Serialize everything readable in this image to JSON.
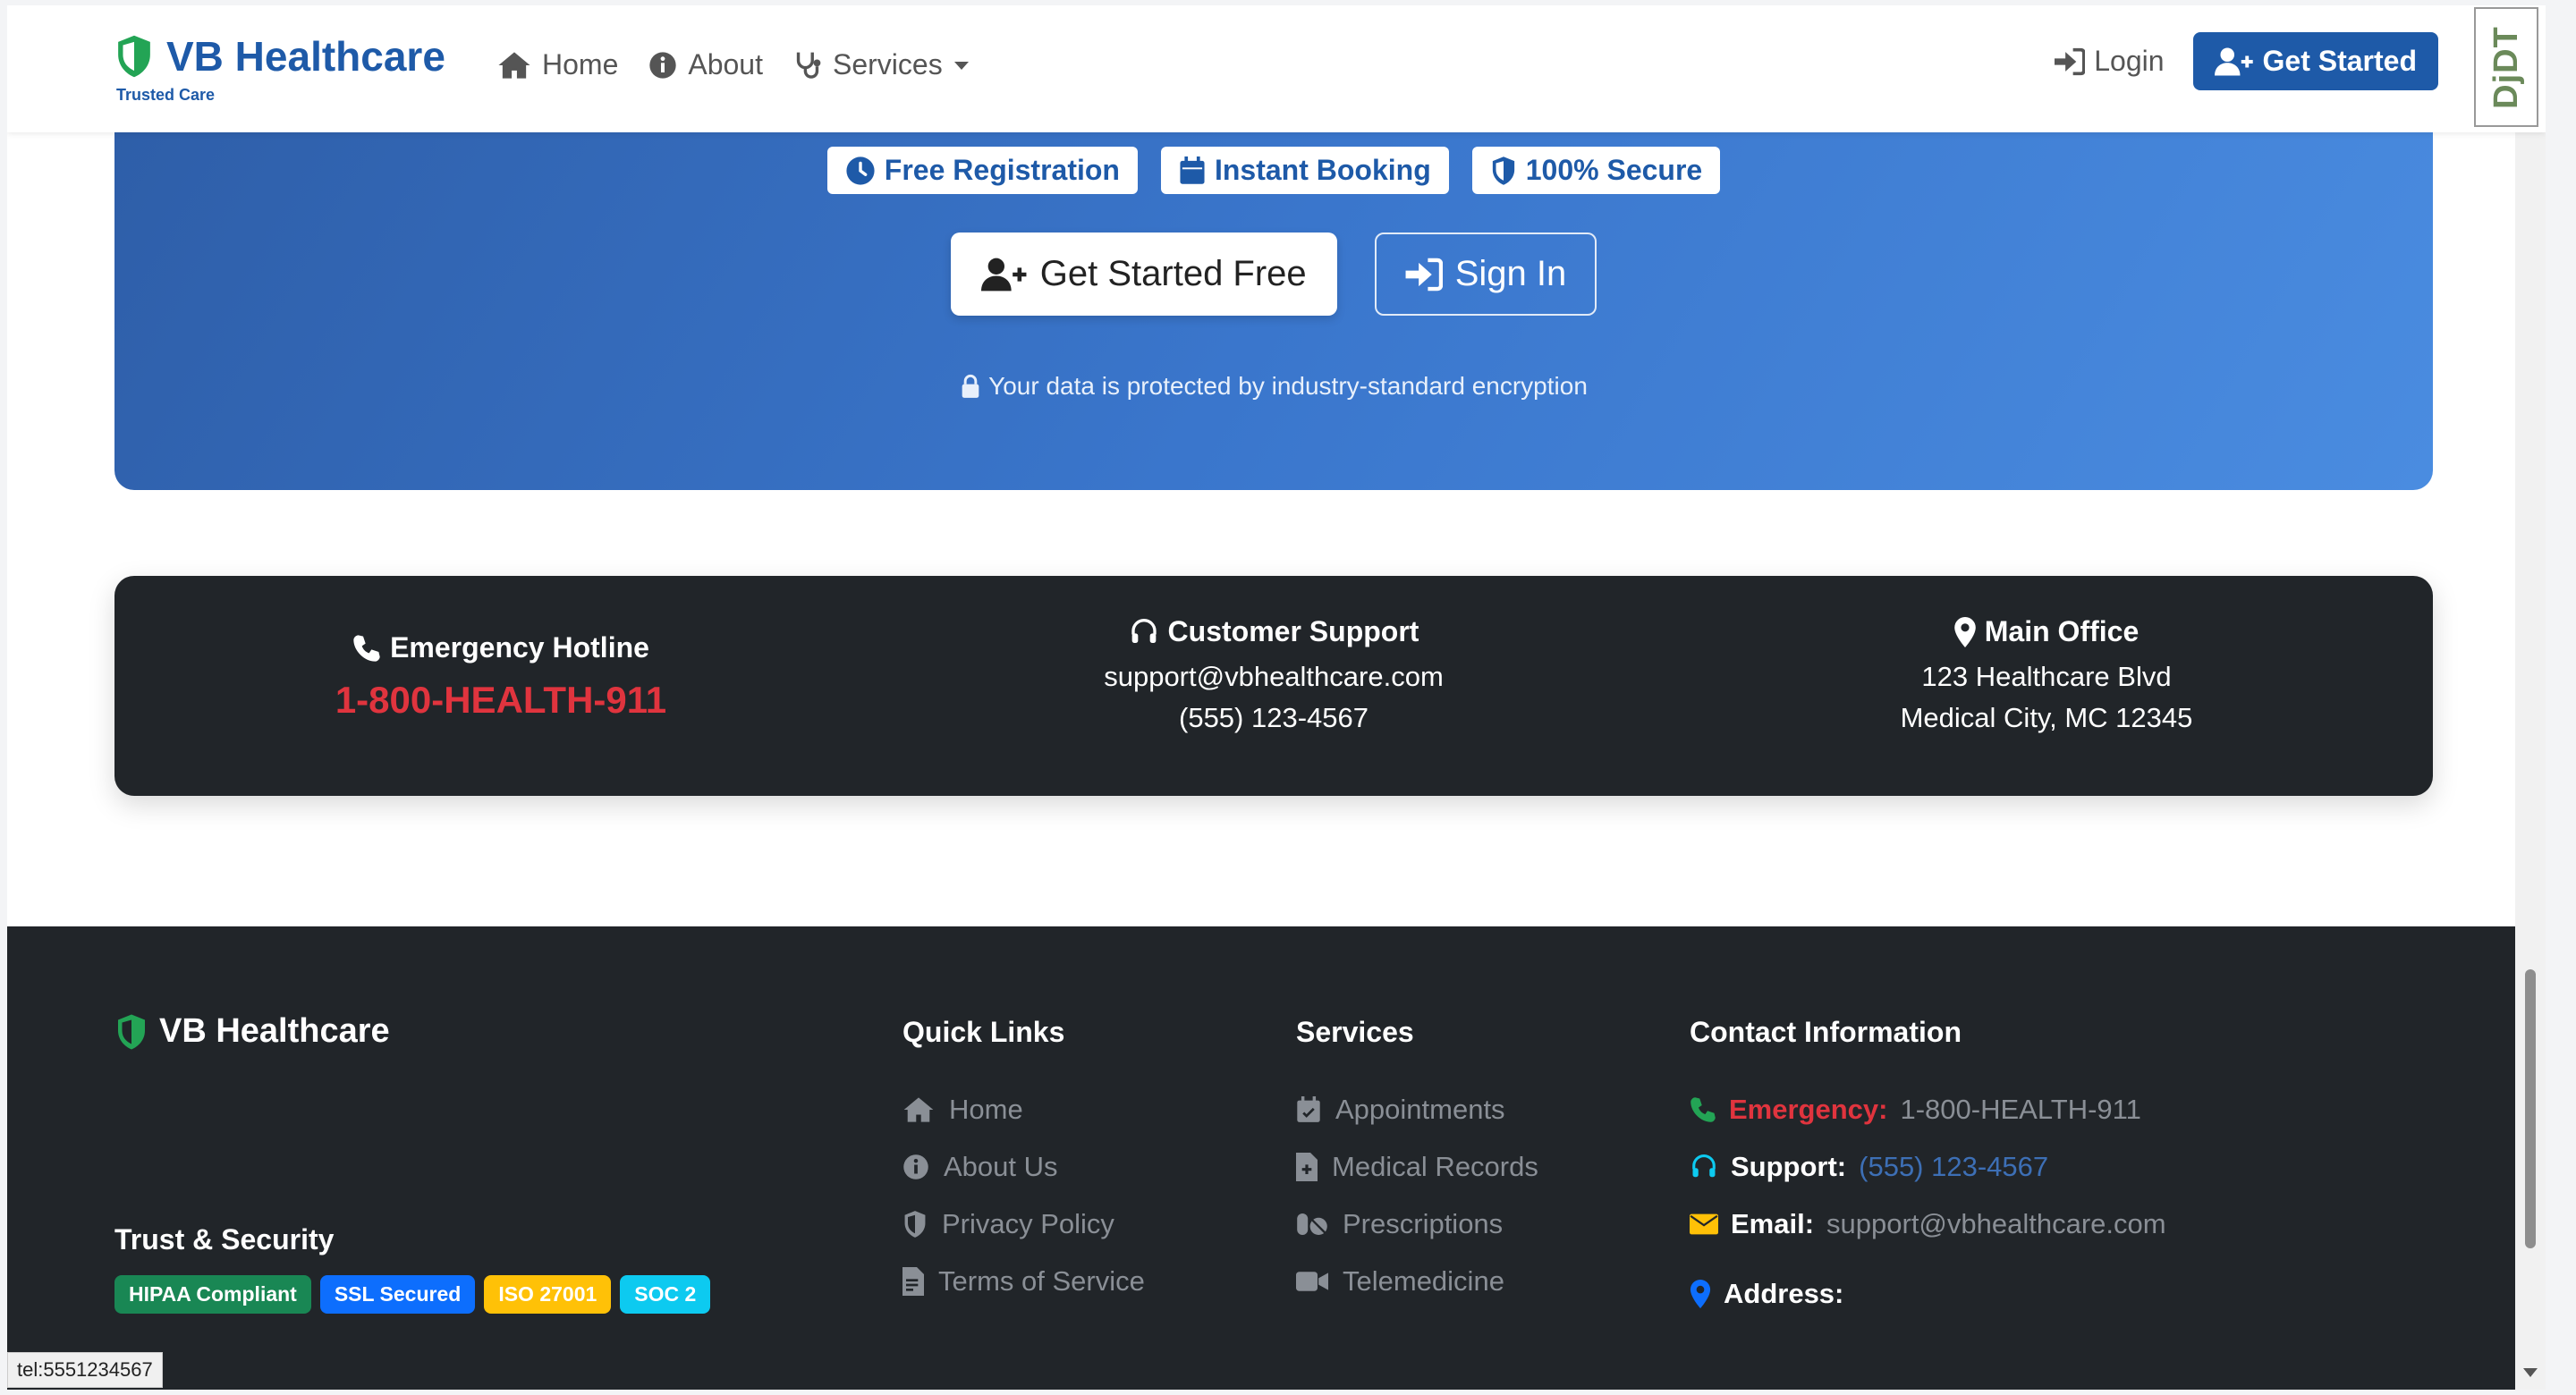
{
  "navbar": {
    "brand_title": "VB Healthcare",
    "brand_subtitle": "Trusted Care",
    "links": [
      {
        "label": "Home",
        "icon": "home-icon"
      },
      {
        "label": "About",
        "icon": "info-icon"
      },
      {
        "label": "Services",
        "icon": "stethoscope-icon"
      }
    ],
    "login_label": "Login",
    "get_started_label": "Get Started"
  },
  "hero": {
    "badges": [
      {
        "label": "Free Registration",
        "icon": "clock-icon"
      },
      {
        "label": "Instant Booking",
        "icon": "calendar-icon"
      },
      {
        "label": "100% Secure",
        "icon": "shield-icon"
      }
    ],
    "cta_primary": "Get Started Free",
    "cta_secondary": "Sign In",
    "note": "Your data is protected by industry-standard encryption"
  },
  "contact_strip": {
    "emergency_title": "Emergency Hotline",
    "emergency_number": "1-800-HEALTH-911",
    "support_title": "Customer Support",
    "support_email": "support@vbhealthcare.com",
    "support_phone": "(555) 123-4567",
    "office_title": "Main Office",
    "office_line1": "123 Healthcare Blvd",
    "office_line2": "Medical City, MC 12345"
  },
  "footer": {
    "brand": "VB Healthcare",
    "trust_title": "Trust & Security",
    "trust_badges": [
      {
        "label": "HIPAA Compliant",
        "color": "#198754"
      },
      {
        "label": "SSL Secured",
        "color": "#0d6efd"
      },
      {
        "label": "ISO 27001",
        "color": "#ffc107"
      },
      {
        "label": "SOC 2",
        "color": "#0dcaf0"
      }
    ],
    "quick_links_title": "Quick Links",
    "quick_links": [
      "Home",
      "About Us",
      "Privacy Policy",
      "Terms of Service"
    ],
    "services_title": "Services",
    "services": [
      "Appointments",
      "Medical Records",
      "Prescriptions",
      "Telemedicine"
    ],
    "contact_title": "Contact Information",
    "contact": {
      "emergency_label": "Emergency:",
      "emergency_value": "1-800-HEALTH-911",
      "support_label": "Support:",
      "support_value": "(555) 123-4567",
      "email_label": "Email:",
      "email_value": "support@vbhealthcare.com",
      "address_label": "Address:"
    }
  },
  "djdt_label": "DjDT",
  "status_url": "tel:5551234567",
  "colors": {
    "brand": "#1e5aa8",
    "emergency": "#e0343e",
    "footer_bg": "#212529"
  }
}
